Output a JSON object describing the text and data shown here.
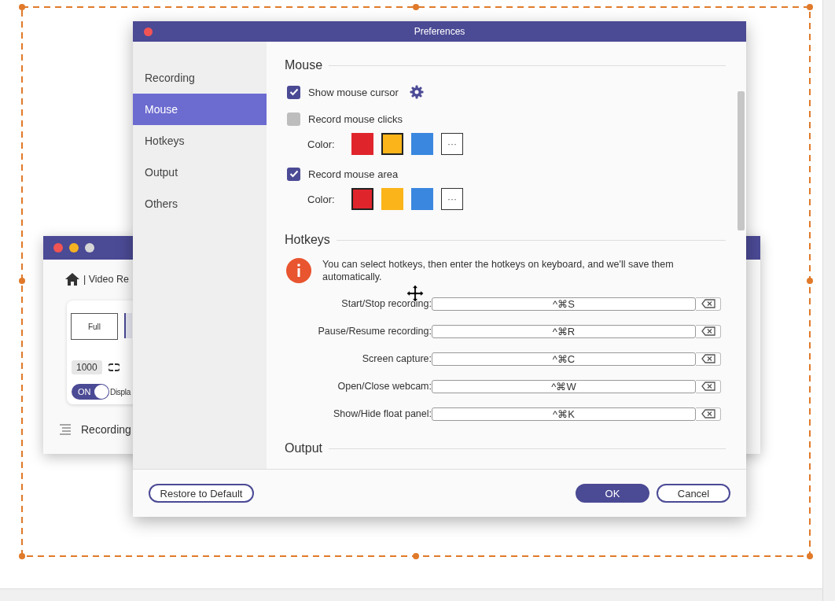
{
  "back_window": {
    "breadcrumb": "| Video Re",
    "mode_label": "Full",
    "width_value": "1000",
    "toggle": {
      "label": "ON",
      "on": true
    },
    "toggle_caption": "Displa",
    "footer_label": "Recording"
  },
  "preferences": {
    "title": "Preferences",
    "sidebar": [
      {
        "label": "Recording",
        "selected": false
      },
      {
        "label": "Mouse",
        "selected": true
      },
      {
        "label": "Hotkeys",
        "selected": false
      },
      {
        "label": "Output",
        "selected": false
      },
      {
        "label": "Others",
        "selected": false
      }
    ],
    "mouse": {
      "heading": "Mouse",
      "options": [
        {
          "label": "Show mouse cursor",
          "checked": true,
          "settings": true
        },
        {
          "label": "Record mouse clicks",
          "checked": false,
          "color_label": "Color:",
          "colors": [
            {
              "color": "#e0242c",
              "selected": false
            },
            {
              "color": "#fbb41a",
              "selected": true
            },
            {
              "color": "#3a87e0",
              "selected": false
            }
          ],
          "more": "···"
        },
        {
          "label": "Record mouse area",
          "checked": true,
          "color_label": "Color:",
          "colors": [
            {
              "color": "#e0242c",
              "selected": true
            },
            {
              "color": "#fbb41a",
              "selected": false
            },
            {
              "color": "#3a87e0",
              "selected": false
            }
          ],
          "more": "···"
        }
      ]
    },
    "hotkeys": {
      "heading": "Hotkeys",
      "info": "You can select hotkeys, then enter the hotkeys on keyboard, and we'll save them automatically.",
      "rows": [
        {
          "label": "Start/Stop recording:",
          "value": "^⌘S"
        },
        {
          "label": "Pause/Resume recording:",
          "value": "^⌘R"
        },
        {
          "label": "Screen capture:",
          "value": "^⌘C"
        },
        {
          "label": "Open/Close webcam:",
          "value": "^⌘W"
        },
        {
          "label": "Show/Hide float panel:",
          "value": "^⌘K"
        }
      ]
    },
    "output": {
      "heading": "Output"
    },
    "buttons": {
      "restore": "Restore to Default",
      "ok": "OK",
      "cancel": "Cancel"
    }
  }
}
